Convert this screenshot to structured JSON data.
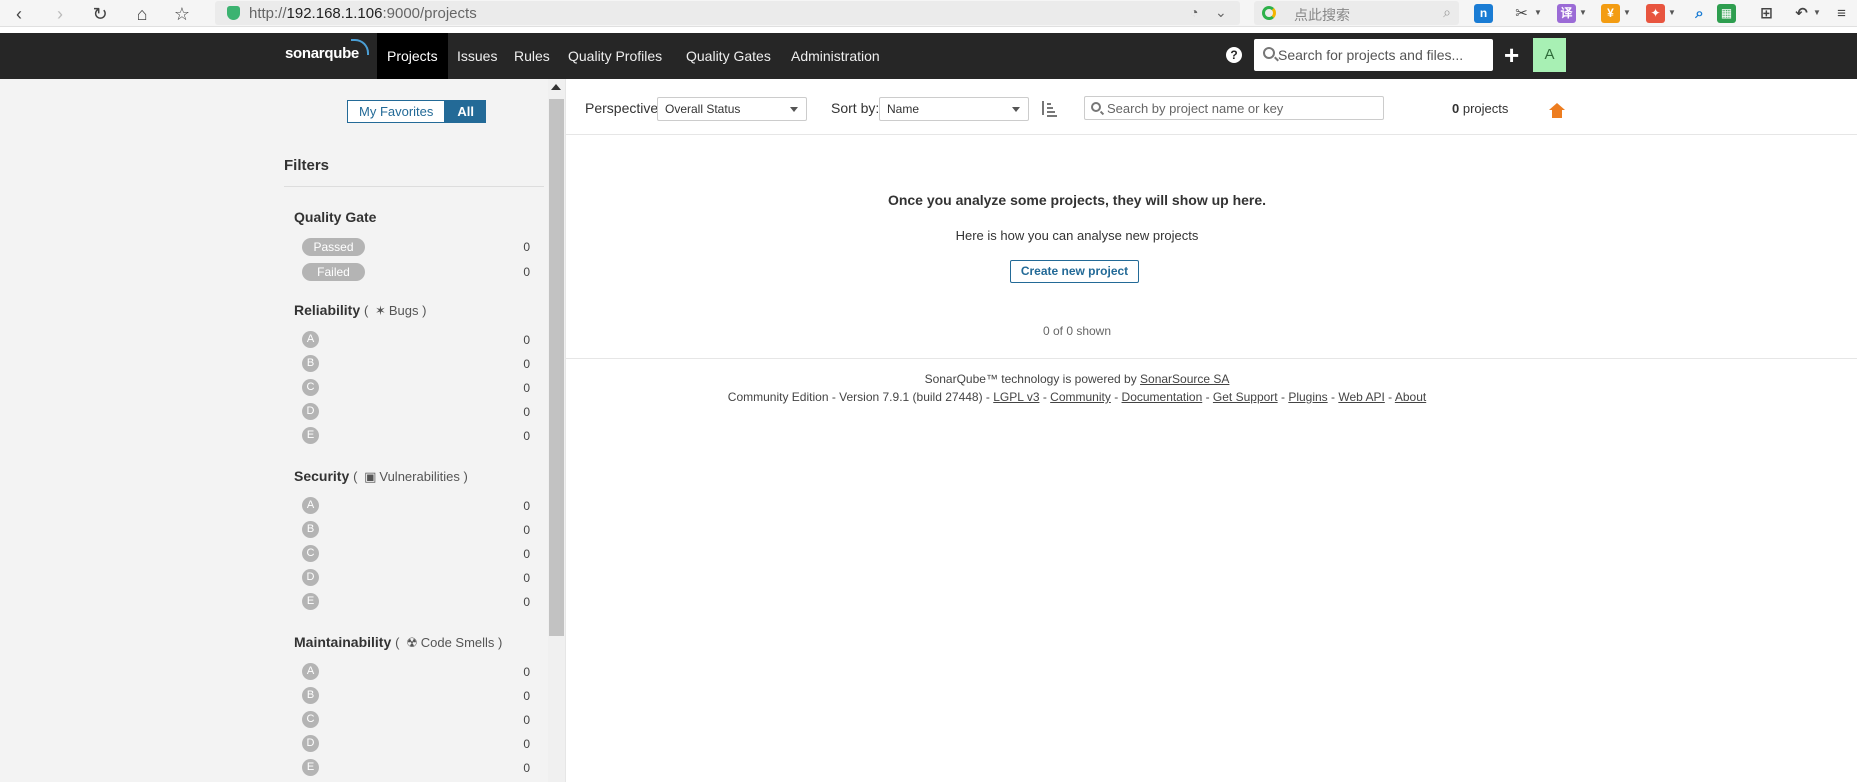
{
  "browser": {
    "url_prefix": "http://",
    "url_host": "192.168.1.106",
    "url_rest": ":9000/projects",
    "search_placeholder": "点此搜索",
    "ext_translate_label": "译",
    "ext_sale_label": "¥"
  },
  "topnav": {
    "logo": "sonarqube",
    "items": [
      "Projects",
      "Issues",
      "Rules",
      "Quality Profiles",
      "Quality Gates",
      "Administration"
    ],
    "active_item": "Projects",
    "help_label": "?",
    "search_placeholder": "Search for projects and files...",
    "plus_label": "+",
    "avatar_letter": "A",
    "avatar_color": "#a8f0b4"
  },
  "sidebar": {
    "favorites_label": "My Favorites",
    "all_label": "All",
    "filters_title": "Filters",
    "quality_gate": {
      "title": "Quality Gate",
      "options": [
        {
          "label": "Passed",
          "count": "0"
        },
        {
          "label": "Failed",
          "count": "0"
        }
      ]
    },
    "reliability": {
      "title": "Reliability",
      "sub_label": "Bugs",
      "icon": "bug-icon",
      "ratings": [
        {
          "label": "A",
          "count": "0"
        },
        {
          "label": "B",
          "count": "0"
        },
        {
          "label": "C",
          "count": "0"
        },
        {
          "label": "D",
          "count": "0"
        },
        {
          "label": "E",
          "count": "0"
        }
      ]
    },
    "security": {
      "title": "Security",
      "sub_label": "Vulnerabilities",
      "icon": "lock-icon",
      "ratings": [
        {
          "label": "A",
          "count": "0"
        },
        {
          "label": "B",
          "count": "0"
        },
        {
          "label": "C",
          "count": "0"
        },
        {
          "label": "D",
          "count": "0"
        },
        {
          "label": "E",
          "count": "0"
        }
      ]
    },
    "maintainability": {
      "title": "Maintainability",
      "sub_label": "Code Smells",
      "icon": "code-smell-icon",
      "ratings": [
        {
          "label": "A",
          "count": "0"
        },
        {
          "label": "B",
          "count": "0"
        },
        {
          "label": "C",
          "count": "0"
        },
        {
          "label": "D",
          "count": "0"
        },
        {
          "label": "E",
          "count": "0"
        }
      ]
    }
  },
  "main": {
    "perspective_label": "Perspective:",
    "perspective_value": "Overall Status",
    "sortby_label": "Sort by:",
    "sortby_value": "Name",
    "search_placeholder": "Search by project name or key",
    "project_count": "0",
    "project_count_suffix": "projects",
    "empty_title": "Once you analyze some projects, they will show up here.",
    "empty_subtitle": "Here is how you can analyse new projects",
    "create_button": "Create new project",
    "shown_text": "0 of 0 shown",
    "accent_color": "#236a97",
    "home_color": "#ed7d20"
  },
  "footer": {
    "line1_prefix": "SonarQube™ technology is powered by ",
    "line1_link": "SonarSource SA",
    "line2_prefix": "Community Edition - Version 7.9.1 (build 27448) - ",
    "links": [
      "LGPL v3",
      "Community",
      "Documentation",
      "Get Support",
      "Plugins",
      "Web API",
      "About"
    ],
    "separator": " - "
  }
}
